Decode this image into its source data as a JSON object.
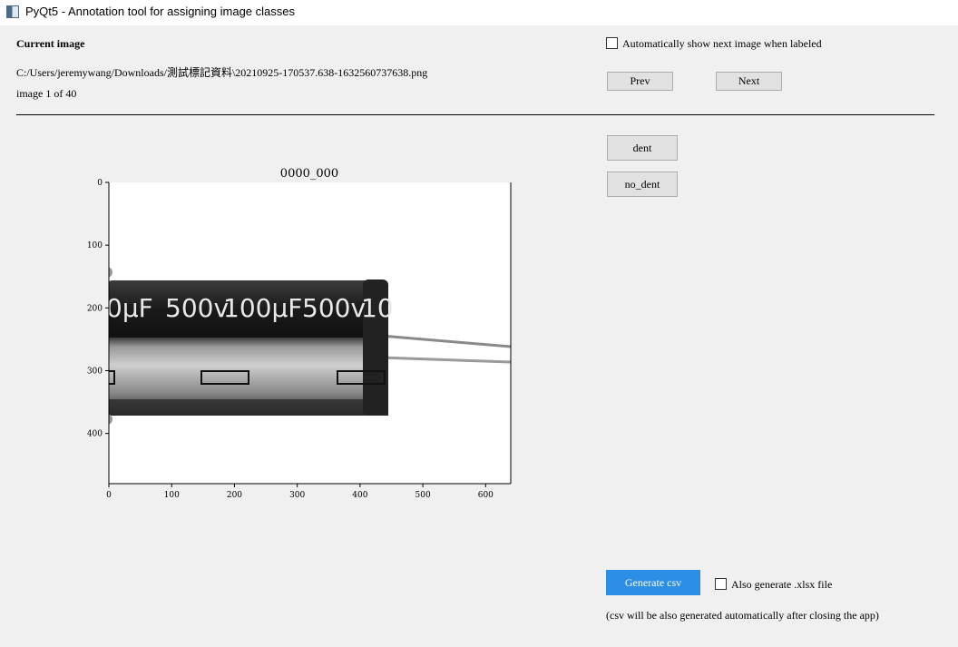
{
  "window": {
    "title": "PyQt5 - Annotation tool for assigning image classes",
    "icon": "qt-window-icon"
  },
  "header": {
    "current_label": "Current image",
    "path": "C:/Users/jeremywang/Downloads/測試標記資料\\20210925-170537.638-1632560737638.png",
    "counter": "image 1 of 40"
  },
  "options": {
    "auto_next_label": "Automatically show next image when labeled",
    "auto_next_checked": false
  },
  "nav": {
    "prev_label": "Prev",
    "next_label": "Next"
  },
  "classes": [
    {
      "label": "dent"
    },
    {
      "label": "no_dent"
    }
  ],
  "export": {
    "generate_label": "Generate csv",
    "xlsx_label": "Also generate .xlsx file",
    "xlsx_checked": false,
    "note": "(csv will be also generated automatically after closing the app)",
    "button_color": "#2d8ee6"
  },
  "chart_data": {
    "type": "image",
    "title": "0000_000",
    "xlim": [
      0,
      640
    ],
    "ylim": [
      480,
      0
    ],
    "x_ticks": [
      "0",
      "100",
      "200",
      "300",
      "400",
      "500",
      "600"
    ],
    "y_ticks": [
      "0",
      "100",
      "200",
      "300",
      "400"
    ],
    "image_content": {
      "capacitor_print": [
        "0μF",
        "500v",
        "100μF",
        "500v",
        "10"
      ]
    }
  }
}
